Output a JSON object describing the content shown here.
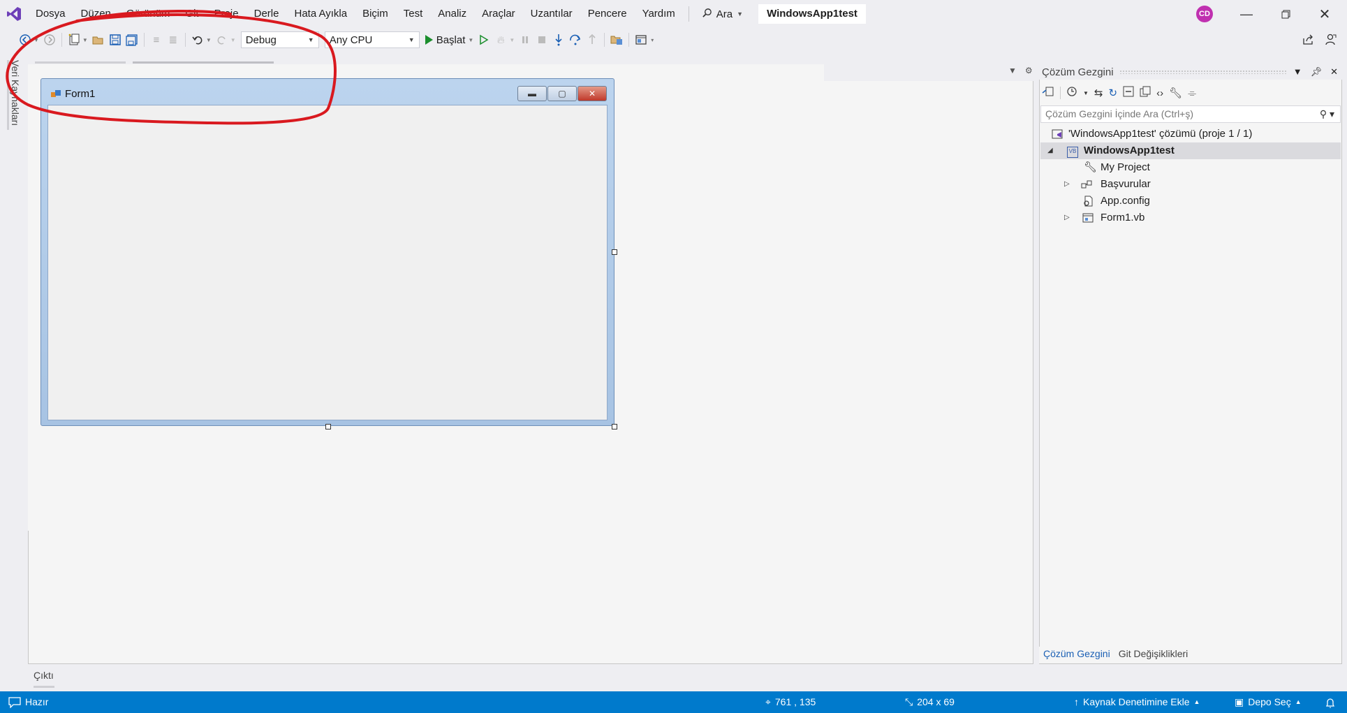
{
  "menubar": {
    "items": [
      "Dosya",
      "Düzen",
      "Görünüm",
      "Git",
      "Proje",
      "Derle",
      "Hata Ayıkla",
      "Biçim",
      "Test",
      "Analiz",
      "Araçlar",
      "Uzantılar",
      "Pencere",
      "Yardım"
    ],
    "search_label": "Ara",
    "window_title": "WindowsApp1test",
    "user_initials": "CD"
  },
  "toolbar": {
    "config_value": "Debug",
    "platform_value": "Any CPU",
    "start_label": "Başlat"
  },
  "left_tab": {
    "label": "Veri Kaynakları"
  },
  "form": {
    "title": "Form1"
  },
  "solution_explorer": {
    "title": "Çözüm Gezgini",
    "search_placeholder": "Çözüm Gezgini İçinde Ara (Ctrl+ş)",
    "tree": {
      "solution": "'WindowsApp1test' çözümü (proje 1 / 1)",
      "project": "WindowsApp1test",
      "project_badge": "VB",
      "items": [
        "My Project",
        "Başvurular",
        "App.config",
        "Form1.vb"
      ]
    },
    "tabs": [
      "Çözüm Gezgini",
      "Git Değişiklikleri"
    ]
  },
  "output": {
    "label": "Çıktı"
  },
  "statusbar": {
    "ready": "Hazır",
    "position": "761 , 135",
    "size": "204 x 69",
    "source_control": "Kaynak Denetimine Ekle",
    "repo": "Depo Seç"
  },
  "colors": {
    "statusbar": "#007acc",
    "annotation": "#d9191f",
    "avatar": "#c030b0"
  }
}
